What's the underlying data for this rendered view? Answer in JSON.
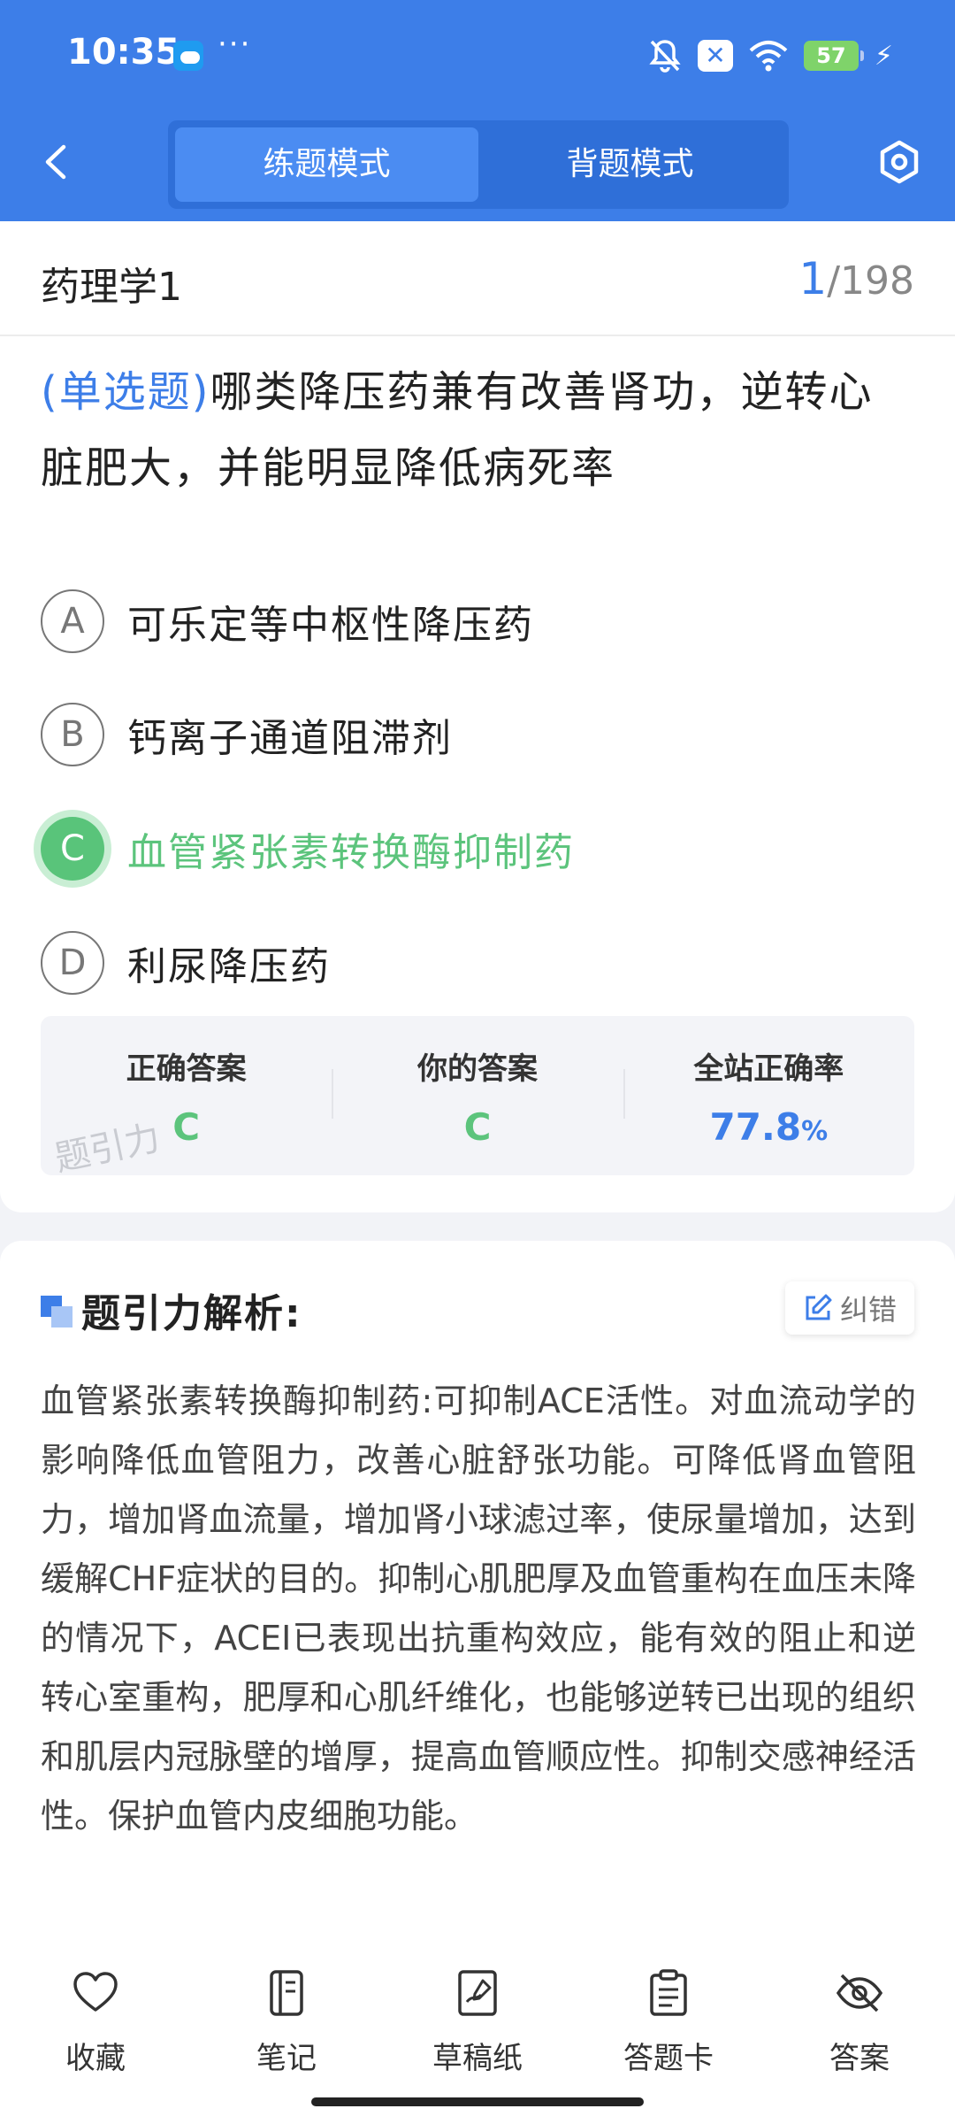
{
  "status_bar": {
    "time": "10:35",
    "more": "···",
    "battery": "57",
    "weather_icon": "weather-icon"
  },
  "header": {
    "tabs": [
      {
        "label": "练题模式",
        "active": true
      },
      {
        "label": "背题模式",
        "active": false
      }
    ]
  },
  "subject": {
    "title": "药理学1",
    "current": "1",
    "total": "/198"
  },
  "question": {
    "type": "(单选题)",
    "text": "哪类降压药兼有改善肾功，逆转心脏肥大，并能明显降低病死率",
    "options": [
      {
        "letter": "A",
        "text": "可乐定等中枢性降压药",
        "state": "normal"
      },
      {
        "letter": "B",
        "text": "钙离子通道阻滞剂",
        "state": "normal"
      },
      {
        "letter": "C",
        "text": "血管紧张素转换酶抑制药",
        "state": "correct"
      },
      {
        "letter": "D",
        "text": "利尿降压药",
        "state": "normal"
      }
    ]
  },
  "answer_summary": {
    "correct_label": "正确答案",
    "correct_value": "C",
    "yours_label": "你的答案",
    "yours_value": "C",
    "rate_label": "全站正确率",
    "rate_value": "77.8",
    "rate_unit": "%",
    "watermark": "题引力"
  },
  "analysis": {
    "title": "题引力解析:",
    "report_label": "纠错",
    "text": "血管紧张素转换酶抑制药:可抑制ACE活性。对血流动学的影响降低血管阻力，改善心脏舒张功能。可降低肾血管阻力，增加肾血流量，增加肾小球滤过率，使尿量增加，达到缓解CHF症状的目的。抑制心肌肥厚及血管重构在血压未降的情况下，ACEI已表现出抗重构效应，能有效的阻止和逆转心室重构，肥厚和心肌纤维化，也能够逆转已出现的组织和肌层内冠脉壁的增厚，提高血管顺应性。抑制交感神经活性。保护血管内皮细胞功能。"
  },
  "bottom_nav": [
    {
      "label": "收藏",
      "icon": "heart-icon"
    },
    {
      "label": "笔记",
      "icon": "notebook-icon"
    },
    {
      "label": "草稿纸",
      "icon": "draft-icon"
    },
    {
      "label": "答题卡",
      "icon": "answer-card-icon"
    },
    {
      "label": "答案",
      "icon": "eye-off-icon"
    }
  ],
  "colors": {
    "primary": "#3d7ee8",
    "correct": "#59c47a"
  }
}
